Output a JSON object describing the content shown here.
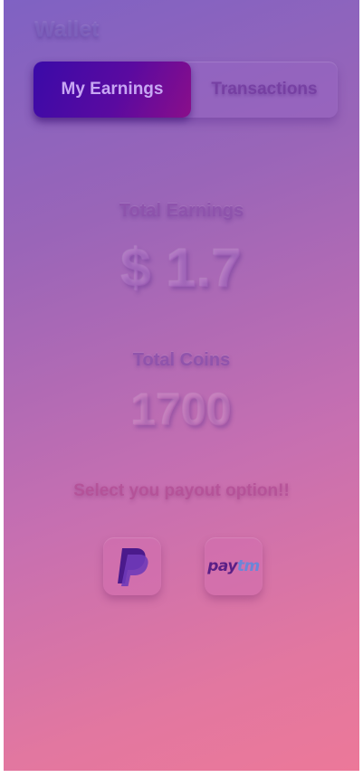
{
  "header": {
    "title": "Wallet"
  },
  "tabs": [
    {
      "label": "My Earnings",
      "active": true
    },
    {
      "label": "Transactions",
      "active": false
    }
  ],
  "earnings": {
    "label": "Total Earnings",
    "value": "$ 1.7"
  },
  "coins": {
    "label": "Total Coins",
    "value": "1700"
  },
  "payout": {
    "prompt": "Select you payout option!!",
    "options": [
      {
        "name": "PayPal",
        "icon": "paypal-logo-icon"
      },
      {
        "name": "Paytm",
        "icon": "paytm-logo-icon",
        "logo_text_pay": "pay",
        "logo_text_tm": "tm"
      }
    ]
  },
  "colors": {
    "active_tab_start": "#3a0aa8",
    "active_tab_end": "#8a0e8a",
    "gradient_top": "#7f62c3",
    "gradient_bottom": "#ec7899",
    "paypal_dark": "#4b1a8c",
    "paypal_light": "#6f3ab8"
  }
}
